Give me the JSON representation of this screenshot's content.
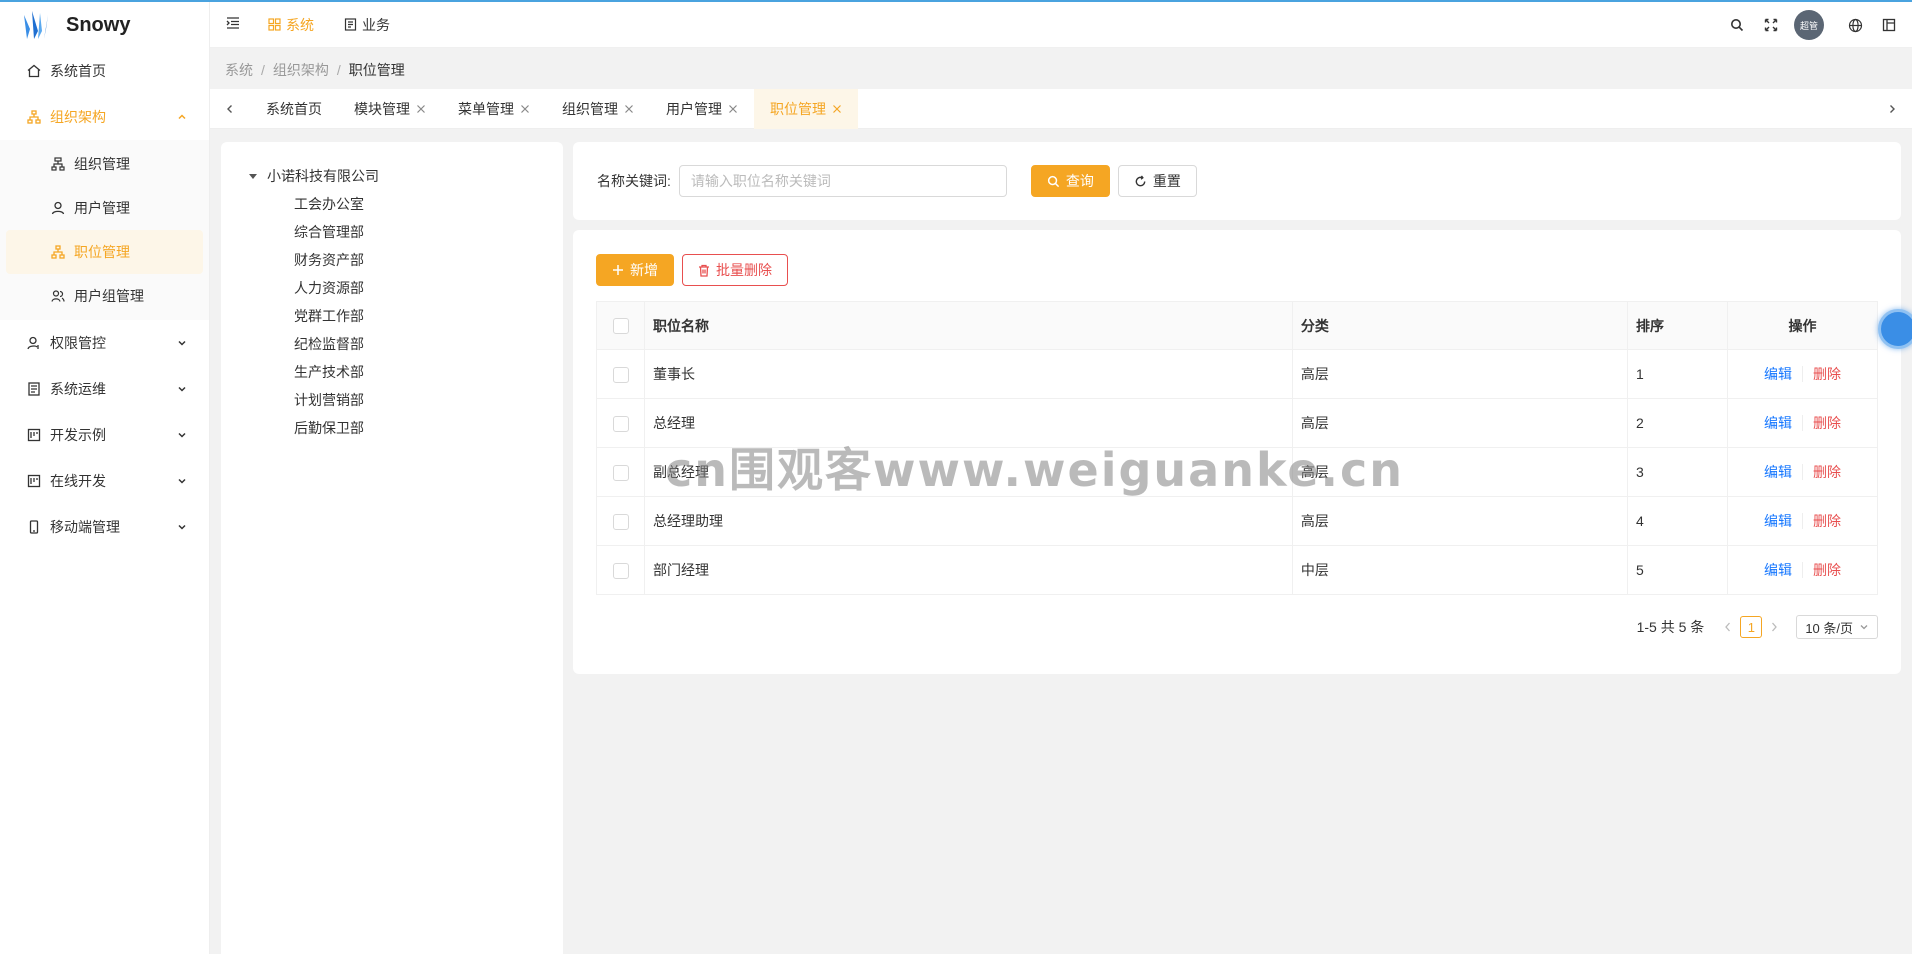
{
  "app": {
    "name": "Snowy"
  },
  "colors": {
    "accent": "#f5a623",
    "link": "#1677ff",
    "danger": "#e84f4f"
  },
  "sidebar": {
    "items": [
      {
        "label": "系统首页",
        "icon": "home-icon"
      },
      {
        "label": "组织架构",
        "icon": "org-icon",
        "open": true,
        "children": [
          {
            "label": "组织管理",
            "icon": "org-tree-icon"
          },
          {
            "label": "用户管理",
            "icon": "user-icon"
          },
          {
            "label": "职位管理",
            "icon": "position-icon",
            "active": true
          },
          {
            "label": "用户组管理",
            "icon": "user-group-icon"
          }
        ]
      },
      {
        "label": "权限管控",
        "icon": "user-shield-icon"
      },
      {
        "label": "系统运维",
        "icon": "ops-icon"
      },
      {
        "label": "开发示例",
        "icon": "dev-icon"
      },
      {
        "label": "在线开发",
        "icon": "online-dev-icon"
      },
      {
        "label": "移动端管理",
        "icon": "mobile-icon"
      }
    ]
  },
  "header": {
    "modules": [
      {
        "label": "系统",
        "active": true
      },
      {
        "label": "业务"
      }
    ],
    "avatar_text": "超管"
  },
  "breadcrumb": [
    "系统",
    "组织架构",
    "职位管理"
  ],
  "tabs": [
    {
      "label": "系统首页",
      "closable": false
    },
    {
      "label": "模块管理",
      "closable": true
    },
    {
      "label": "菜单管理",
      "closable": true
    },
    {
      "label": "组织管理",
      "closable": true
    },
    {
      "label": "用户管理",
      "closable": true
    },
    {
      "label": "职位管理",
      "closable": true,
      "active": true
    }
  ],
  "tree": {
    "root": "小诺科技有限公司",
    "children": [
      "工会办公室",
      "综合管理部",
      "财务资产部",
      "人力资源部",
      "党群工作部",
      "纪检监督部",
      "生产技术部",
      "计划营销部",
      "后勤保卫部"
    ]
  },
  "search": {
    "label": "名称关键词:",
    "placeholder": "请输入职位名称关键词",
    "query_label": "查询",
    "reset_label": "重置"
  },
  "toolbar": {
    "add_label": "新增",
    "batch_delete_label": "批量删除"
  },
  "table": {
    "columns": [
      "职位名称",
      "分类",
      "排序",
      "操作"
    ],
    "rows": [
      {
        "name": "董事长",
        "category": "高层",
        "sort": "1"
      },
      {
        "name": "总经理",
        "category": "高层",
        "sort": "2"
      },
      {
        "name": "副总经理",
        "category": "高层",
        "sort": "3"
      },
      {
        "name": "总经理助理",
        "category": "高层",
        "sort": "4"
      },
      {
        "name": "部门经理",
        "category": "中层",
        "sort": "5"
      }
    ],
    "edit_label": "编辑",
    "delete_label": "删除"
  },
  "pagination": {
    "summary": "1-5 共 5 条",
    "current": "1",
    "page_size": "10 条/页"
  },
  "watermark": "cn围观客www.weiguanke.cn"
}
